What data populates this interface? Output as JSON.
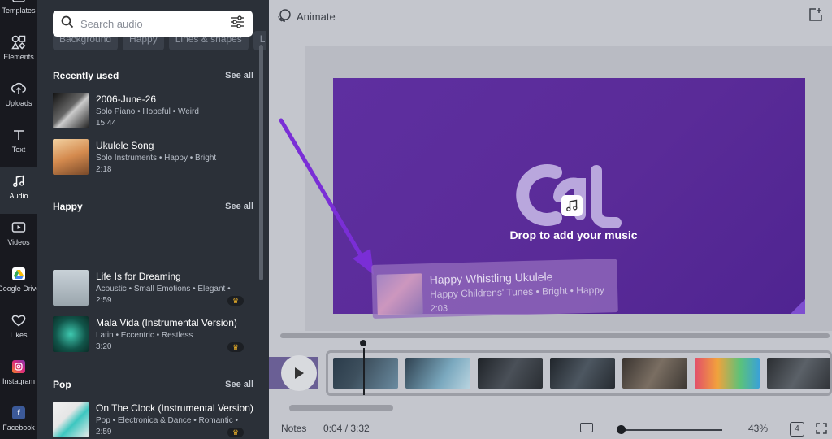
{
  "rail": {
    "items": [
      {
        "label": "Templates",
        "icon": "templates-icon"
      },
      {
        "label": "Elements",
        "icon": "elements-icon"
      },
      {
        "label": "Uploads",
        "icon": "upload-icon"
      },
      {
        "label": "Text",
        "icon": "text-icon"
      },
      {
        "label": "Audio",
        "icon": "music-note-icon",
        "active": true
      },
      {
        "label": "Videos",
        "icon": "video-icon"
      },
      {
        "label": "Google Drive",
        "icon": "google-drive-icon"
      },
      {
        "label": "Likes",
        "icon": "heart-icon"
      },
      {
        "label": "Instagram",
        "icon": "instagram-icon"
      },
      {
        "label": "Facebook",
        "icon": "facebook-icon"
      }
    ]
  },
  "panel": {
    "search_placeholder": "Search audio",
    "chips": [
      "Background",
      "Happy",
      "Lines & shapes",
      "Love"
    ],
    "sections": [
      {
        "title": "Recently used",
        "see_all": "See all",
        "tracks": [
          {
            "title": "2006-June-26",
            "meta": "Solo Piano • Hopeful • Weird",
            "duration": "15:44",
            "premium": false
          },
          {
            "title": "Ukulele Song",
            "meta": "Solo Instruments • Happy • Bright",
            "duration": "2:18",
            "premium": false
          }
        ]
      },
      {
        "title": "Happy",
        "see_all": "See all",
        "tracks": [
          {
            "title": "Life Is for Dreaming",
            "meta": "Acoustic • Small Emotions • Elegant •",
            "duration": "2:59",
            "premium": true
          },
          {
            "title": "Mala Vida (Instrumental Version)",
            "meta": "Latin • Eccentric • Restless",
            "duration": "3:20",
            "premium": true
          }
        ]
      },
      {
        "title": "Pop",
        "see_all": "See all",
        "tracks": [
          {
            "title": "On The Clock (Instrumental Version)",
            "meta": "Pop • Electronica & Dance • Romantic •",
            "duration": "2:59",
            "premium": true
          }
        ]
      }
    ]
  },
  "editor": {
    "animate_label": "Animate",
    "drop_text": "Drop to add your music",
    "drag_card": {
      "title": "Happy Whistling Ukulele",
      "meta": "Happy Childrens' Tunes • Bright • Happy",
      "duration": "2:03"
    }
  },
  "bottombar": {
    "notes_label": "Notes",
    "time": "0:04 / 3:32",
    "zoom": "43%",
    "page_count": "4"
  },
  "colors": {
    "slide": "#5a2b98",
    "arrow": "#7a2ed6",
    "panel_bg": "#2b3038",
    "rail_bg": "#18191f",
    "premium_crown": "#f0b429"
  }
}
